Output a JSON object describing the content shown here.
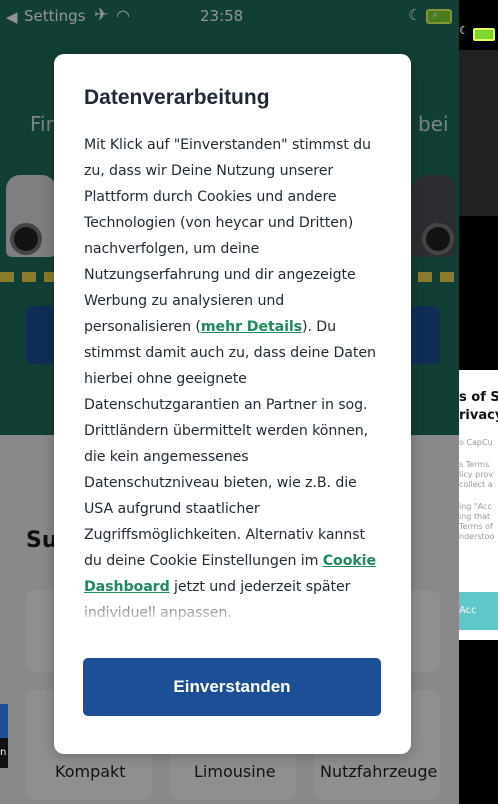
{
  "status_bar": {
    "back_label": "◀",
    "carrier": "Settings",
    "plane": "✈",
    "wifi": "◠",
    "time": "23:58",
    "moon": "☾",
    "battery_bolt": "⚡"
  },
  "background": {
    "hero_left": "Fir",
    "hero_right": "bei",
    "section_title": "Su",
    "categories": [
      "Kompakt",
      "Limousine",
      "Nutzfahrzeuge"
    ]
  },
  "modal": {
    "title": "Datenverarbeitung",
    "text_1": "Mit Klick auf \"Einverstanden\" stimmst du zu, dass wir Deine Nutzung unserer Plattform durch Cookies und andere Technologien (von heycar und Dritten) nachverfolgen, um deine Nutzungserfahrung und dir angezeigte Werbung zu analysieren und personalisieren (",
    "link_details": "mehr Details",
    "text_2": "). Du stimmst damit auch zu, dass deine Daten hierbei ohne geeignete Datenschutzgarantien an Partner in sog. Drittländern übermittelt werden können, die kein angemessenes Datenschutzniveau bieten, wie z.B. die USA aufgrund staatlicher Zugriffsmöglichkeiten. Alternativ kannst du deine Cookie Einstellungen im ",
    "link_dashboard": "Cookie Dashboard",
    "text_3": " jetzt und jederzeit später individuell anpassen.",
    "button_label": "Einverstanden"
  },
  "side_app": {
    "heading_1": "s of S",
    "heading_2": "rivacy",
    "lines": [
      "o CapCu",
      "s Terms",
      "licy prov",
      "collect a",
      "ing \"Acc",
      "ing that",
      "Terms of",
      "nderstoo"
    ],
    "accept_label": "Acc"
  },
  "left_sliver": {
    "label": "n"
  },
  "colors": {
    "brand_green": "#1f6d5c",
    "primary_blue": "#1c4f96",
    "link_green": "#1f8a5c",
    "side_accent": "#5fc7c9"
  }
}
